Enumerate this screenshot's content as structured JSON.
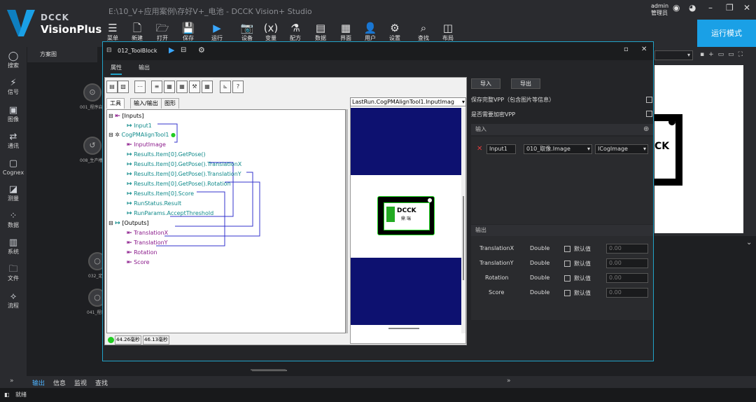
{
  "app": {
    "brand_top": "DCCK",
    "brand_bottom": "VisionPlus",
    "title": "E:\\10_V+应用案例\\存好V+_电池 - DCCK Vision+ Studio",
    "user_name": "admin",
    "user_role": "管理员",
    "run_mode_label": "运行模式",
    "accent": "#1aa0e6"
  },
  "toolbar": [
    {
      "icon": "menu-icon",
      "label": "菜单"
    },
    {
      "icon": "new-file-icon",
      "label": "新建"
    },
    {
      "icon": "folder-open-icon",
      "label": "打开"
    },
    {
      "icon": "save-icon",
      "label": "保存"
    },
    {
      "icon": "run-icon",
      "label": "运行"
    },
    {
      "icon": "device-icon",
      "label": "设备"
    },
    {
      "icon": "variable-icon",
      "label": "变量"
    },
    {
      "icon": "recipe-icon",
      "label": "配方"
    },
    {
      "icon": "data-icon",
      "label": "数据"
    },
    {
      "icon": "ui-icon",
      "label": "界面"
    },
    {
      "icon": "user-icon",
      "label": "用户"
    },
    {
      "icon": "settings-icon",
      "label": "设置"
    },
    {
      "icon": "search-icon",
      "label": "查找"
    },
    {
      "icon": "layout-icon",
      "label": "布局"
    }
  ],
  "sidebar": [
    {
      "icon": "search-icon",
      "label": "搜索"
    },
    {
      "icon": "signal-icon",
      "label": "信号"
    },
    {
      "icon": "image-icon",
      "label": "图像"
    },
    {
      "icon": "comms-icon",
      "label": "通讯"
    },
    {
      "icon": "cognex-icon",
      "label": "Cognex"
    },
    {
      "icon": "measure-icon",
      "label": "测量"
    },
    {
      "icon": "data-icon",
      "label": "数据"
    },
    {
      "icon": "system-icon",
      "label": "系统"
    },
    {
      "icon": "file-icon",
      "label": "文件"
    },
    {
      "icon": "flow-icon",
      "label": "流程"
    }
  ],
  "canvas": {
    "header": "方案图",
    "nodes": [
      {
        "label": "001_程序启"
      },
      {
        "label": "008_生产槽"
      },
      {
        "label": "032_定"
      },
      {
        "label": "041_程序"
      }
    ]
  },
  "dialog": {
    "title": "012_ToolBlock",
    "tabs": [
      "属性",
      "输出"
    ],
    "sub_tabs": [
      "工具",
      "输入/输出",
      "图形"
    ],
    "image_select": "LastRun.CogPMAlignTool1.InputImag",
    "status_times": [
      "44.26毫秒",
      "46.13毫秒"
    ],
    "tree": [
      {
        "text": "[Inputs]",
        "kind": "group"
      },
      {
        "text": "Input1",
        "kind": "out"
      },
      {
        "text": "CogPMAlignTool1",
        "kind": "tool"
      },
      {
        "text": "InputImage",
        "kind": "in"
      },
      {
        "text": "Results.Item[0].GetPose()",
        "kind": "out"
      },
      {
        "text": "Results.Item[0].GetPose().TranslationX",
        "kind": "out"
      },
      {
        "text": "Results.Item[0].GetPose().TranslationY",
        "kind": "out"
      },
      {
        "text": "Results.Item[0].GetPose().Rotation",
        "kind": "out"
      },
      {
        "text": "Results.Item[0].Score",
        "kind": "out"
      },
      {
        "text": "RunStatus.Result",
        "kind": "out"
      },
      {
        "text": "RunParams.AcceptThreshold",
        "kind": "out"
      },
      {
        "text": "[Outputs]",
        "kind": "group"
      },
      {
        "text": "TranslationX",
        "kind": "in"
      },
      {
        "text": "TranslationY",
        "kind": "in"
      },
      {
        "text": "Rotation",
        "kind": "in"
      },
      {
        "text": "Score",
        "kind": "in"
      }
    ],
    "image_labels": {
      "brand": "DCCK",
      "sub": "鼎 瑞"
    }
  },
  "props": {
    "import_label": "导入",
    "export_label": "导出",
    "save_full_vpp": "保存完整VPP（包含图片等信息）",
    "encrypt_vpp": "是否需要加密VPP",
    "input_section": "输入",
    "input_row": {
      "name": "Input1",
      "source": "010_取像.Image",
      "type": "ICogImage"
    },
    "output_section": "输出",
    "default_label": "默认值",
    "outputs": [
      {
        "name": "TranslationX",
        "type": "Double",
        "value": "0.00"
      },
      {
        "name": "TranslationY",
        "type": "Double",
        "value": "0.00"
      },
      {
        "name": "Rotation",
        "type": "Double",
        "value": "0.00"
      },
      {
        "name": "Score",
        "type": "Double",
        "value": "0.00"
      }
    ]
  },
  "bottom_tabs": [
    "输出",
    "信息",
    "监视",
    "查找"
  ],
  "status": "就绪"
}
